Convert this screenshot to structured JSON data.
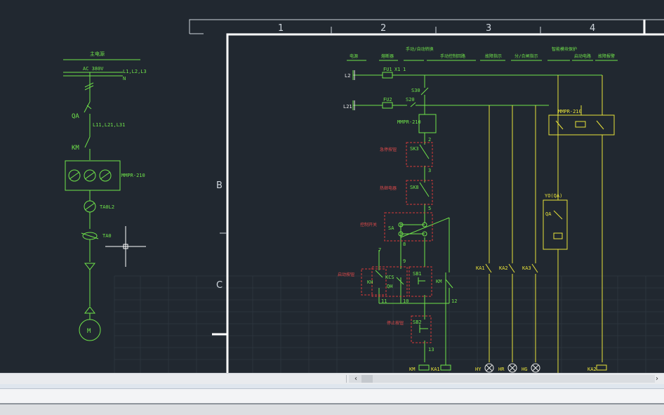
{
  "drawing": {
    "zone_columns": [
      "1",
      "2",
      "3",
      "4"
    ],
    "zone_rows": [
      "B",
      "C"
    ],
    "header_labels": [
      "电源",
      "熔断器",
      "手动/自动转换",
      "手动控制回路",
      "故障指示",
      "分/合闸指示",
      "智能模块保护",
      "启动电路",
      "故障报警"
    ],
    "one_line": {
      "title": "主电源",
      "supply_label": "AC 380V",
      "phase_labels": "L1,L2,L3",
      "neutral_label": "N",
      "breaker_tag": "QA",
      "breaker_terminals": "L11,L21,L31",
      "contactor_tag": "KM",
      "module_label": "MMPR-210",
      "ct_label": "TA0L2",
      "ct2_label": "TA0",
      "motor_label": "M"
    },
    "schematic": {
      "line_l2": "L2",
      "line_l21": "L21",
      "fuse1": "FU1",
      "fuse2": "FU2",
      "terminal_x1": "X1",
      "terminal_1": "1",
      "switch_s30": "S30",
      "switch_s20": "S20",
      "module_mmpr": "MMPR-210",
      "sa_label": "SA",
      "sk3": "SK3",
      "sk8": "SK8",
      "sb1": "SB1",
      "sb2": "SB2",
      "km": "KM",
      "kcs": "KCS",
      "qh": "QH",
      "kh": "KH",
      "ka1": "KA1",
      "ka2": "KA2",
      "ka3": "KA3",
      "yo_label": "YO(QA)",
      "qa_label": "QA",
      "mmpr_right": "MMPR-210",
      "coil_km": "KM",
      "coil_ka1": "KA1",
      "lamp_hy": "HY",
      "lamp_hr": "HR",
      "lamp_hg": "HG",
      "coil_ka2": "KA2",
      "red_box_labels": [
        "急停按钮",
        "热继电器",
        "控制开关",
        "启动按钮",
        "停止按钮"
      ],
      "wire_numbers": [
        "2",
        "3",
        "5",
        "7",
        "8",
        "9",
        "10",
        "11",
        "12",
        "13"
      ]
    }
  },
  "scrollbar": {
    "left_arrow": "‹",
    "right_arrow": "›"
  },
  "colors": {
    "background": "#212830",
    "wire_green": "#6fe34a",
    "wire_yellow": "#e8e23a",
    "frame_white": "#ffffff",
    "dashed_red": "#d83a3a"
  }
}
